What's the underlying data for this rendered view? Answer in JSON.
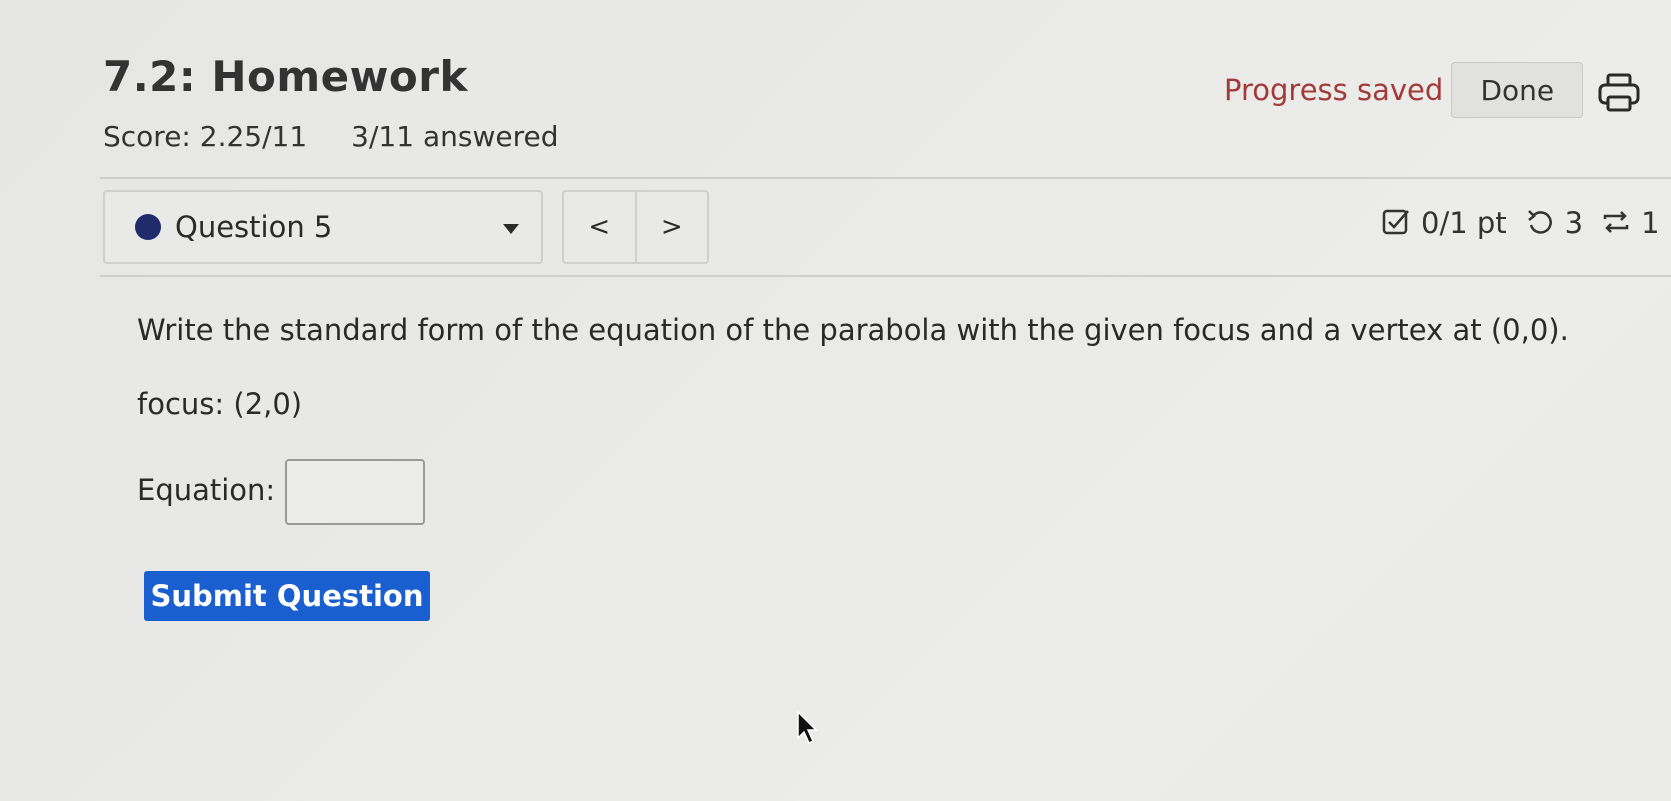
{
  "header": {
    "title": "7.2: Homework",
    "score": "Score: 2.25/11",
    "answered": "3/11 answered",
    "progress_status": "Progress saved",
    "done_label": "Done"
  },
  "question_nav": {
    "selected_question": "Question 5",
    "prev_label": "<",
    "next_label": ">",
    "points": "0/1 pt",
    "attempts_remaining": "3",
    "retries": "1"
  },
  "question": {
    "prompt": "Write the standard form of the equation of the parabola with the given focus and a vertex at (0,0).",
    "focus": "focus: (2,0)",
    "equation_label": "Equation:",
    "equation_value": "",
    "submit_label": "Submit Question"
  },
  "colors": {
    "accent_blue": "#1a5fd0",
    "status_red": "#a33a3a",
    "question_dot": "#1f2b6b"
  },
  "icons": {
    "print": "print-icon",
    "points": "checkbox-icon",
    "attempts": "undo-icon",
    "retries": "repeat-icon",
    "dropdown": "caret-down-icon",
    "cursor": "mouse-pointer-icon"
  }
}
